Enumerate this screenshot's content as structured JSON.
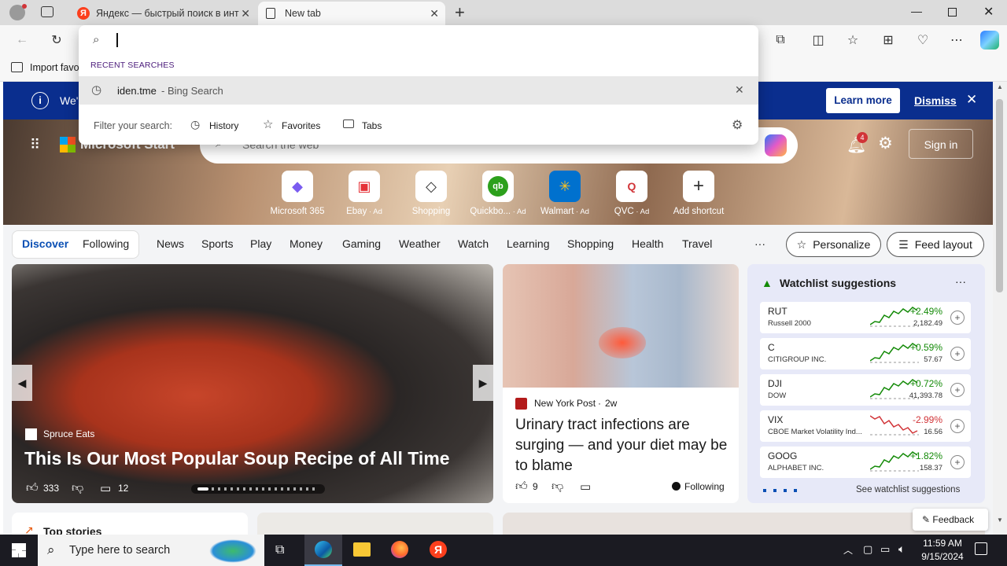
{
  "browser": {
    "tabs": [
      {
        "title": "Яндекс — быстрый поиск в инт"
      },
      {
        "title": "New tab"
      }
    ],
    "favorites_bar": {
      "import_label": "Import favo"
    }
  },
  "omnibox": {
    "section_label": "RECENT SEARCHES",
    "recent": [
      {
        "query": "iden.tme",
        "suffix": " - Bing Search"
      }
    ],
    "filter_label": "Filter your search:",
    "filters": [
      "History",
      "Favorites",
      "Tabs"
    ]
  },
  "notice": {
    "text": "We'",
    "learn_more": "Learn more",
    "dismiss": "Dismiss"
  },
  "header": {
    "brand": "Microsoft Start",
    "search_placeholder": "Search the web",
    "notif_count": "4",
    "sign_in": "Sign in"
  },
  "quick_links": [
    {
      "label": "Microsoft 365",
      "ad": ""
    },
    {
      "label": "Ebay",
      "ad": " · Ad"
    },
    {
      "label": "Shopping",
      "ad": ""
    },
    {
      "label": "Quickbo...",
      "ad": " · Ad"
    },
    {
      "label": "Walmart",
      "ad": " · Ad"
    },
    {
      "label": "QVC",
      "ad": " · Ad"
    },
    {
      "label": "Add shortcut",
      "ad": ""
    }
  ],
  "nav": {
    "discover": "Discover",
    "following": "Following",
    "items": [
      "News",
      "Sports",
      "Play",
      "Money",
      "Gaming",
      "Weather",
      "Watch",
      "Learning",
      "Shopping",
      "Health",
      "Travel"
    ],
    "more": "···",
    "personalize": "Personalize",
    "feed_layout": "Feed layout"
  },
  "hero_story": {
    "source": "Spruce Eats",
    "title": "This Is Our Most Popular Soup Recipe of All Time",
    "likes": "333",
    "comments": "12"
  },
  "story2": {
    "source": "New York Post",
    "age": "2w",
    "title": "Urinary tract infections are surging — and your diet may be to blame",
    "likes": "9",
    "following": "Following"
  },
  "watchlist": {
    "title": "Watchlist suggestions",
    "more": "···",
    "see_more": "See watchlist suggestions",
    "stocks": [
      {
        "symbol": "RUT",
        "name": "Russell 2000",
        "change": "+2.49%",
        "price": "2,182.49",
        "up": true
      },
      {
        "symbol": "C",
        "name": "CITIGROUP INC.",
        "change": "+0.59%",
        "price": "57.67",
        "up": true
      },
      {
        "symbol": "DJI",
        "name": "DOW",
        "change": "+0.72%",
        "price": "41,393.78",
        "up": true
      },
      {
        "symbol": "VIX",
        "name": "CBOE Market Volatility Ind...",
        "change": "-2.99%",
        "price": "16.56",
        "up": false
      },
      {
        "symbol": "GOOG",
        "name": "ALPHABET INC.",
        "change": "+1.82%",
        "price": "158.37",
        "up": true
      }
    ]
  },
  "bottom": {
    "top_stories": "Top stories",
    "feedback": "Feedback"
  },
  "taskbar": {
    "search_placeholder": "Type here to search",
    "time": "11:59 AM",
    "date": "9/15/2024"
  },
  "colors": {
    "accent": "#0067b8",
    "notice_bg": "#0a2e8e",
    "up": "#138a07",
    "down": "#d13438"
  }
}
